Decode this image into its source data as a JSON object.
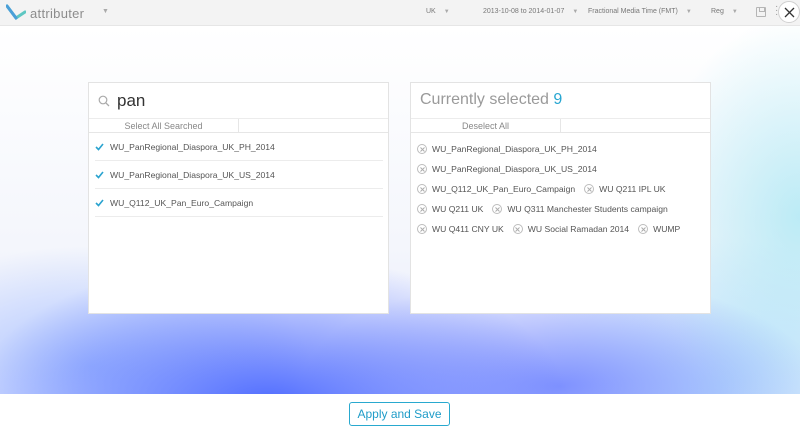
{
  "app": {
    "name": "attributer"
  },
  "filters": {
    "region": "UK",
    "date_range": "2013-10-08 to 2014-01-07",
    "model": "Fractional Media Time (FMT)",
    "view": "Reg"
  },
  "search": {
    "query": "pan",
    "select_all_label": "Select All Searched",
    "results": [
      "WU_PanRegional_Diaspora_UK_PH_2014",
      "WU_PanRegional_Diaspora_UK_US_2014",
      "WU_Q112_UK_Pan_Euro_Campaign"
    ]
  },
  "selected": {
    "title": "Currently selected",
    "count": "9",
    "deselect_all_label": "Deselect All",
    "items": [
      "WU_PanRegional_Diaspora_UK_PH_2014",
      "WU_PanRegional_Diaspora_UK_US_2014",
      "WU_Q112_UK_Pan_Euro_Campaign",
      "WU Q211 IPL UK",
      "WU Q211 UK",
      "WU Q311 Manchester Students campaign",
      "WU Q411 CNY UK",
      "WU Social Ramadan 2014",
      "WUMP"
    ]
  },
  "footer": {
    "apply_label": "Apply and Save"
  },
  "colors": {
    "accent": "#27a6d1",
    "glow": "#4664ff"
  },
  "icons": {
    "logo": "attributer-logo-icon",
    "caret": "chevron-down-icon",
    "search": "search-icon",
    "check": "check-icon",
    "remove": "close-circle-icon",
    "save": "save-icon",
    "more": "more-icon",
    "close": "close-icon"
  }
}
